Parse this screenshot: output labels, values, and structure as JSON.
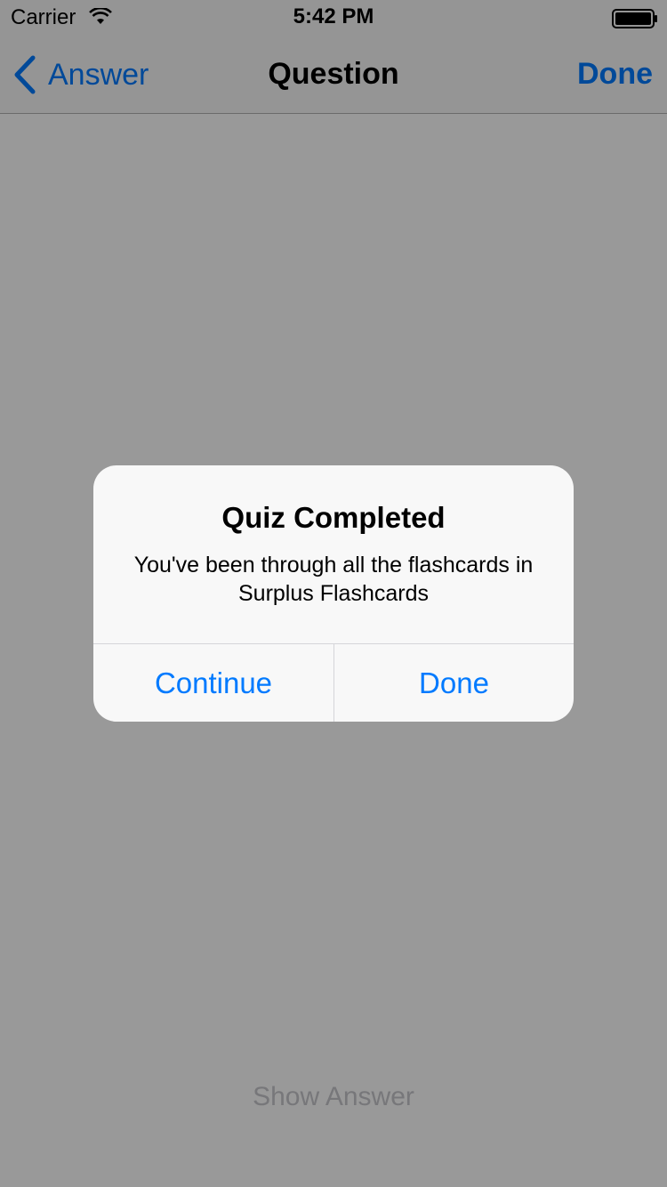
{
  "status_bar": {
    "carrier": "Carrier",
    "time": "5:42 PM",
    "wifi_icon": "wifi-icon",
    "battery_icon": "battery-icon"
  },
  "nav_bar": {
    "back_label": "Answer",
    "title": "Question",
    "done_label": "Done",
    "back_icon": "chevron-left-icon"
  },
  "content": {
    "show_answer_label": "Show Answer"
  },
  "alert": {
    "title": "Quiz Completed",
    "message": "You've been through all the flashcards in Surplus Flashcards",
    "continue_label": "Continue",
    "done_label": "Done"
  },
  "colors": {
    "accent": "#007aff",
    "overlay": "rgba(0,0,0,0.4)",
    "alert_background": "#f8f8f8"
  }
}
